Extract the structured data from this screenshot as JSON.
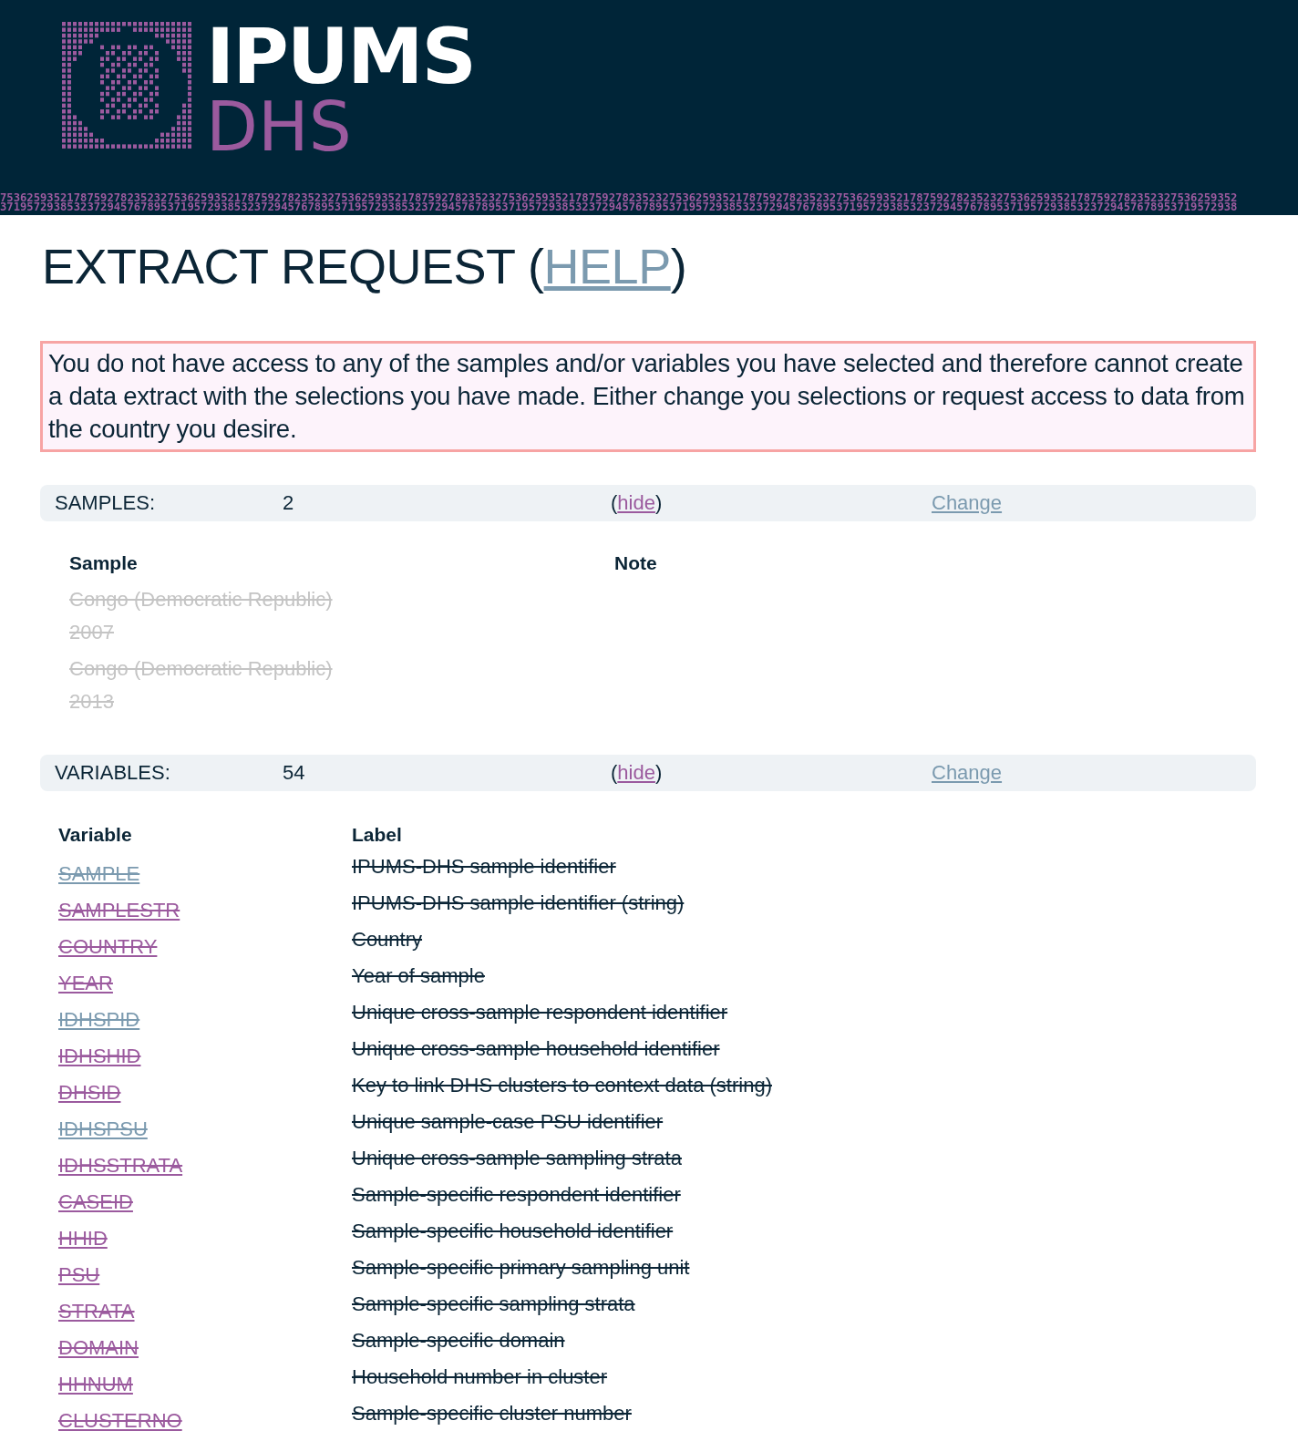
{
  "header": {
    "logo_top": "IPUMS",
    "logo_bottom": "DHS",
    "number_strip": [
      "75362593521787592782352327536259352178759278235232753625935217875927823523275362593521787592782352327536259352178759278235232753625935217875927823523275362593521787592782352327536259352",
      "37195729385323729457678953719572938532372945767895371957293853237294576789537195729385323729457678953719572938532372945767895371957293853237294576789537195729385323729457678953719572938"
    ]
  },
  "title": {
    "text": "EXTRACT REQUEST (",
    "link": "HELP",
    "close": ")"
  },
  "alert": "You do not have access to any of the samples and/or variables you have selected and therefore cannot create a data extract with the selections you have made. Either change you selections or request access to data from the country you desire.",
  "samples_section": {
    "label": "SAMPLES:",
    "count": "2",
    "hide_open": "(",
    "hide": "hide",
    "hide_close": ")",
    "change": "Change",
    "columns": [
      "Sample",
      "Note"
    ],
    "rows": [
      {
        "sample": "Congo (Democratic Republic) 2007",
        "unavailable": true
      },
      {
        "sample": "Congo (Democratic Republic) 2013",
        "unavailable": true
      }
    ]
  },
  "variables_section": {
    "label": "VARIABLES:",
    "count": "54",
    "hide_open": "(",
    "hide": "hide",
    "hide_close": ")",
    "change": "Change",
    "columns": [
      "Variable",
      "Label"
    ],
    "rows": [
      {
        "variable": "SAMPLE",
        "label": "IPUMS-DHS sample identifier",
        "visited": true,
        "unavailable": true
      },
      {
        "variable": "SAMPLESTR",
        "label": "IPUMS-DHS sample identifier (string)",
        "visited": false,
        "unavailable": true
      },
      {
        "variable": "COUNTRY",
        "label": "Country",
        "visited": false,
        "unavailable": true
      },
      {
        "variable": "YEAR",
        "label": "Year of sample",
        "visited": false,
        "unavailable": true
      },
      {
        "variable": "IDHSPID",
        "label": "Unique cross-sample respondent identifier",
        "visited": true,
        "unavailable": true
      },
      {
        "variable": "IDHSHID",
        "label": "Unique cross-sample household identifier",
        "visited": false,
        "unavailable": true
      },
      {
        "variable": "DHSID",
        "label": "Key to link DHS clusters to context data (string)",
        "visited": false,
        "unavailable": true
      },
      {
        "variable": "IDHSPSU",
        "label": "Unique sample-case PSU identifier",
        "visited": true,
        "unavailable": true
      },
      {
        "variable": "IDHSSTRATA",
        "label": "Unique cross-sample sampling strata",
        "visited": false,
        "unavailable": true
      },
      {
        "variable": "CASEID",
        "label": "Sample-specific respondent identifier",
        "visited": false,
        "unavailable": true
      },
      {
        "variable": "HHID",
        "label": "Sample-specific household identifier",
        "visited": false,
        "unavailable": true
      },
      {
        "variable": "PSU",
        "label": "Sample-specific primary sampling unit",
        "visited": false,
        "unavailable": true
      },
      {
        "variable": "STRATA",
        "label": "Sample-specific sampling strata",
        "visited": false,
        "unavailable": true
      },
      {
        "variable": "DOMAIN",
        "label": "Sample-specific domain",
        "visited": false,
        "unavailable": true
      },
      {
        "variable": "HHNUM",
        "label": "Household number in cluster",
        "visited": false,
        "unavailable": true
      },
      {
        "variable": "CLUSTERNO",
        "label": "Sample-specific cluster number",
        "visited": false,
        "unavailable": true
      }
    ]
  }
}
